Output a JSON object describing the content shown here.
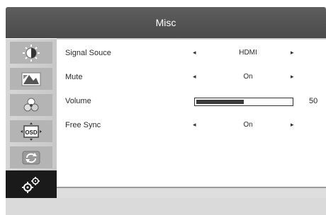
{
  "header": {
    "title": "Misc"
  },
  "sidebar": {
    "tabs": [
      {
        "icon": "brightness-contrast-icon",
        "active": false
      },
      {
        "icon": "image-icon",
        "active": false
      },
      {
        "icon": "color-icon",
        "active": false
      },
      {
        "icon": "osd-icon",
        "active": false
      },
      {
        "icon": "reset-icon",
        "active": false
      },
      {
        "icon": "misc-settings-icon",
        "active": true
      }
    ]
  },
  "settings": {
    "signal_source": {
      "label": "Signal Souce",
      "value": "HDMI"
    },
    "mute": {
      "label": "Mute",
      "value": "On"
    },
    "volume": {
      "label": "Volume",
      "value": "50",
      "level_percent": 50
    },
    "free_sync": {
      "label": "Free Sync",
      "value": "On"
    }
  },
  "arrows": {
    "left": "◂",
    "right": "▸"
  },
  "colors": {
    "header": "#555555",
    "active_tab": "#1a1a1a",
    "slider_fill": "#3a3a3a"
  }
}
